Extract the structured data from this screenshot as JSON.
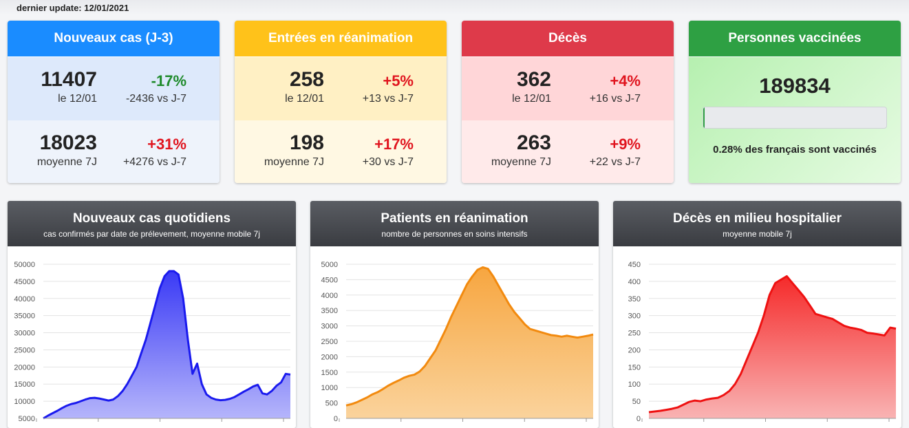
{
  "header": {
    "update_label": "dernier update: 12/01/2021"
  },
  "cards": [
    {
      "title": "Nouveaux cas (J-3)",
      "head_color": "#1a8cff",
      "row1": {
        "value": "11407",
        "sub": "le 12/01",
        "pct": "-17%",
        "pct_color": "green",
        "vs": "-2436 vs J-7",
        "bg": "#dde9fb"
      },
      "row2": {
        "value": "18023",
        "sub": "moyenne 7J",
        "pct": "+31%",
        "pct_color": "red",
        "vs": "+4276 vs J-7",
        "bg": "#eef3fb"
      }
    },
    {
      "title": "Entrées en réanimation",
      "head_color": "#ffc21a",
      "row1": {
        "value": "258",
        "sub": "le 12/01",
        "pct": "+5%",
        "pct_color": "red",
        "vs": "+13 vs J-7",
        "bg": "#fff0c4"
      },
      "row2": {
        "value": "198",
        "sub": "moyenne 7J",
        "pct": "+17%",
        "pct_color": "red",
        "vs": "+30 vs J-7",
        "bg": "#fff8e3"
      }
    },
    {
      "title": "Décès",
      "head_color": "#de3a4a",
      "row1": {
        "value": "362",
        "sub": "le 12/01",
        "pct": "+4%",
        "pct_color": "red",
        "vs": "+16 vs J-7",
        "bg": "#ffd6d8"
      },
      "row2": {
        "value": "263",
        "sub": "moyenne 7J",
        "pct": "+9%",
        "pct_color": "red",
        "vs": "+22 vs J-7",
        "bg": "#ffeaea"
      }
    }
  ],
  "vaccination": {
    "title": "Personnes vaccinées",
    "head_color": "#2ea043",
    "value": "189834",
    "percent": 0.28,
    "text": "0.28% des français sont vaccinés"
  },
  "chart_data": [
    {
      "type": "area",
      "title": "Nouveaux cas quotidiens",
      "subtitle": "cas confirmés par date de prélevement, moyenne mobile 7j",
      "ylim": [
        5000,
        50000
      ],
      "yticks": [
        5000,
        10000,
        15000,
        20000,
        25000,
        30000,
        35000,
        40000,
        45000,
        50000
      ],
      "color": "#1a1aee",
      "fill_top": "#3a3af5",
      "fill_bottom": "#b5b5fb",
      "values": [
        5000,
        5800,
        6500,
        7200,
        8000,
        8700,
        9200,
        9500,
        10000,
        10500,
        10900,
        11000,
        10800,
        10500,
        10200,
        10500,
        11500,
        13000,
        15000,
        17500,
        20000,
        24000,
        28000,
        33000,
        38000,
        43000,
        46500,
        48000,
        48000,
        47000,
        40000,
        28000,
        18000,
        21000,
        15000,
        12000,
        11000,
        10500,
        10300,
        10400,
        10700,
        11200,
        12000,
        12800,
        13500,
        14300,
        14800,
        12300,
        12000,
        13000,
        14500,
        15500,
        18000,
        17800
      ]
    },
    {
      "type": "area",
      "title": "Patients en réanimation",
      "subtitle": "nombre de personnes en soins intensifs",
      "ylim": [
        0,
        5000
      ],
      "yticks": [
        0,
        500,
        1000,
        1500,
        2000,
        2500,
        3000,
        3500,
        4000,
        4500,
        5000
      ],
      "color": "#f28a0f",
      "fill_top": "#f7a640",
      "fill_bottom": "#fad39c",
      "values": [
        420,
        460,
        520,
        600,
        680,
        780,
        850,
        950,
        1060,
        1150,
        1230,
        1320,
        1380,
        1420,
        1520,
        1700,
        1950,
        2200,
        2550,
        2900,
        3300,
        3650,
        4000,
        4350,
        4600,
        4820,
        4900,
        4850,
        4600,
        4300,
        4000,
        3700,
        3450,
        3250,
        3050,
        2900,
        2850,
        2800,
        2750,
        2700,
        2680,
        2650,
        2680,
        2650,
        2620,
        2650,
        2680,
        2720
      ]
    },
    {
      "type": "area",
      "title": "Décès en milieu hospitalier",
      "subtitle": "moyenne mobile 7j",
      "ylim": [
        0,
        450
      ],
      "yticks": [
        0,
        50,
        100,
        150,
        200,
        250,
        300,
        350,
        400,
        450
      ],
      "color": "#ee1111",
      "fill_top": "#f52a2a",
      "fill_bottom": "#f9b3b3",
      "values": [
        18,
        20,
        22,
        25,
        28,
        32,
        40,
        48,
        52,
        50,
        55,
        58,
        60,
        68,
        80,
        100,
        130,
        170,
        210,
        250,
        300,
        360,
        395,
        405,
        415,
        395,
        375,
        355,
        330,
        305,
        300,
        295,
        290,
        280,
        270,
        265,
        262,
        258,
        250,
        248,
        245,
        242,
        265,
        262
      ]
    }
  ]
}
